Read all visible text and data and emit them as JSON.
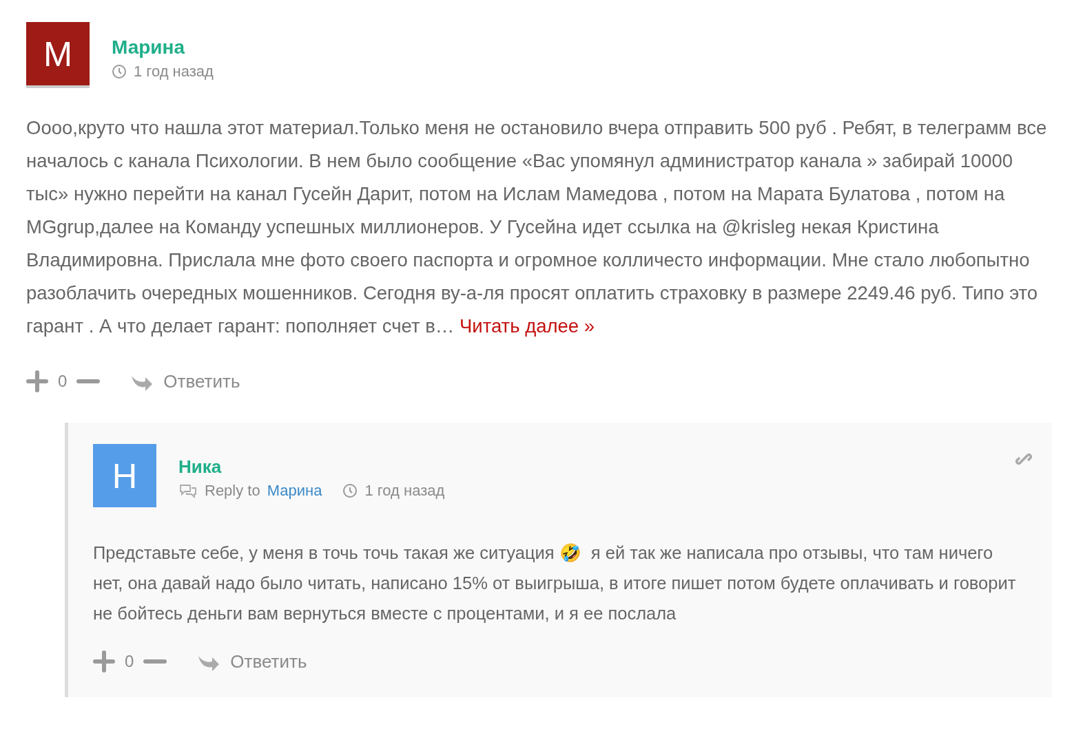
{
  "comment": {
    "avatar_letter": "M",
    "color": "#9e1b16",
    "author": "Марина",
    "time": "1 год назад",
    "text": "Оооо,круто что нашла этот материал.Только меня не остановило вчера отправить 500 руб . Ребят, в телеграмм все началось с канала Психологии. В нем было сообщение «Вас упомянул администратор канала » забирай 10000 тыс» нужно перейти на канал Гусейн Дарит, потом на Ислам Мамедова , потом на Марата Булатова , потом на MGgrup,далее на Команду успешных миллионеров. У Гусейна идет ссылка на @krisleg некая Кристина Владимировна. Прислала мне фото своего паспорта и огромное колличесто информации. Мне стало любопытно разоблачить очередных мошенников. Сегодня ву-а-ля просят оплатить страховку в размере 2249.46 руб. Типо это гарант . А что делает гарант: пополняет счет в…",
    "read_more": "Читать далее »",
    "votes": "0",
    "reply": "Ответить",
    "replies": [
      {
        "avatar_letter": "Н",
        "color": "#559de8",
        "author": "Ника",
        "reply_to_label": "Reply to",
        "reply_to": "Марина",
        "time": "1 год назад",
        "text": "Представьте себе, у меня в точь точь такая же ситуация 🤣  я ей так же написала про отзывы, что там ничего нет, она давай надо было читать, написано 15% от выигрыша, в итоге пишет потом будете оплачивать и говорит не бойтесь деньги вам вернуться вместе с процентами, и я ее послала",
        "votes": "0",
        "reply": "Ответить"
      }
    ]
  }
}
